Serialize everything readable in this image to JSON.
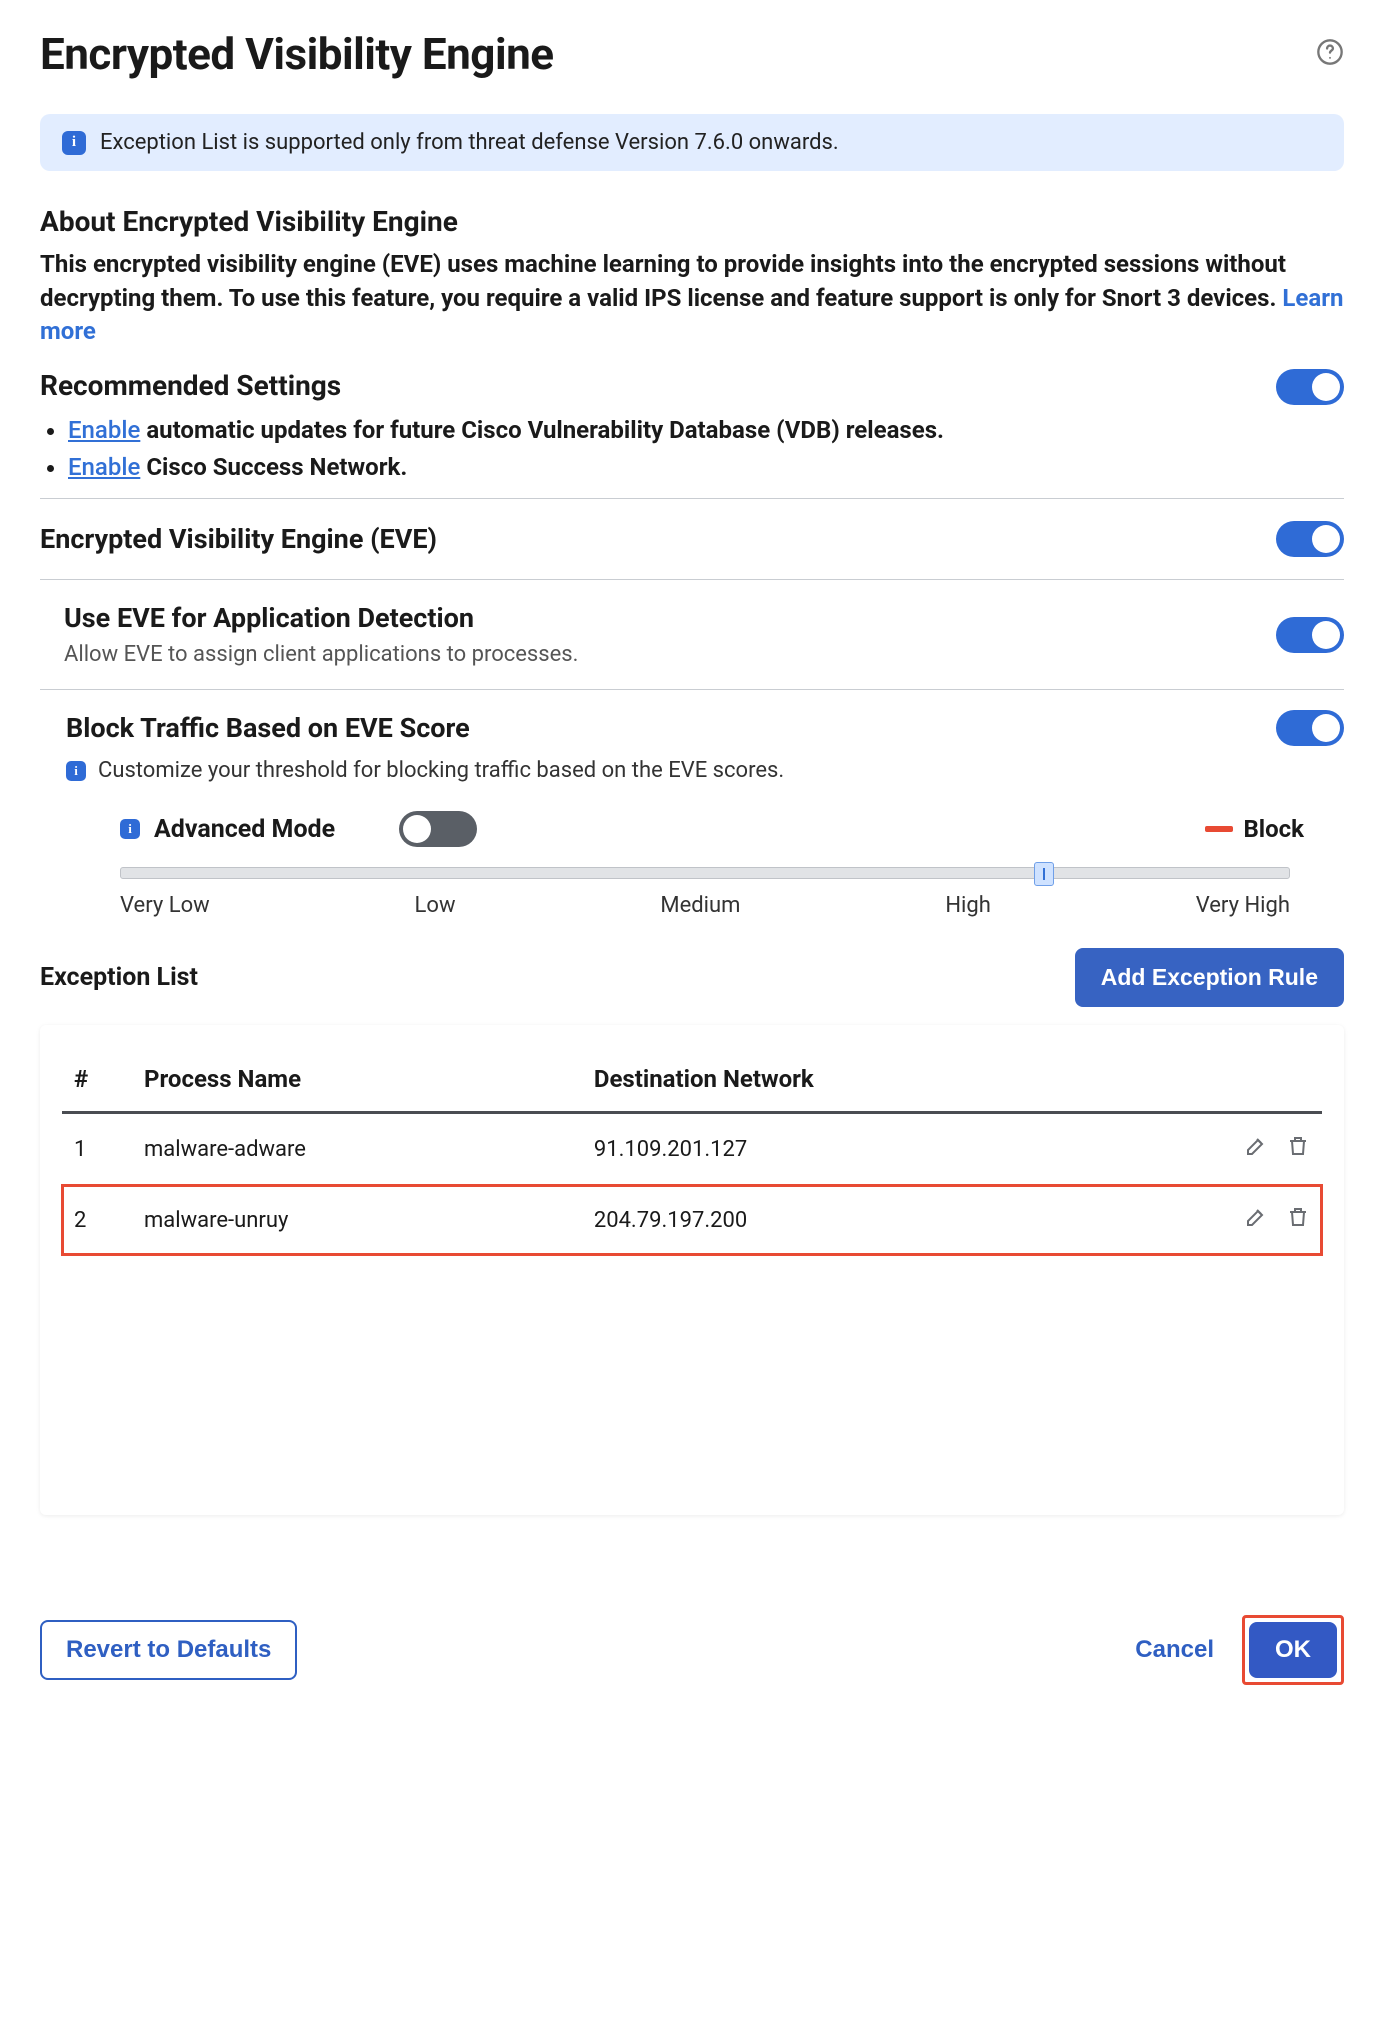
{
  "header": {
    "title": "Encrypted Visibility Engine"
  },
  "banner": {
    "text": "Exception List is supported only from threat defense Version 7.6.0 onwards."
  },
  "about": {
    "heading": "About Encrypted Visibility Engine",
    "body": "This encrypted visibility engine (EVE) uses machine learning to provide insights into the encrypted sessions without decrypting them. To use this feature, you require a valid IPS license and feature support is only for Snort 3 devices. ",
    "learn_more": "Learn more"
  },
  "recommended": {
    "heading": "Recommended Settings",
    "enable_label": "Enable",
    "items": [
      "automatic updates for future Cisco Vulnerability Database (VDB) releases.",
      "Cisco Success Network."
    ]
  },
  "eve_section": {
    "title": "Encrypted Visibility Engine (EVE)"
  },
  "app_detect": {
    "title": "Use EVE for Application Detection",
    "sub": "Allow EVE to assign client applications to processes."
  },
  "block_section": {
    "title": "Block Traffic Based on EVE Score",
    "sub": "Customize your threshold for blocking traffic based on the EVE scores.",
    "advanced_label": "Advanced Mode",
    "legend": "Block",
    "ticks": [
      "Very Low",
      "Low",
      "Medium",
      "High",
      "Very High"
    ]
  },
  "exception": {
    "heading": "Exception List",
    "add_button": "Add Exception Rule",
    "columns": {
      "idx": "#",
      "process": "Process Name",
      "dest": "Destination Network"
    },
    "rows": [
      {
        "idx": "1",
        "process": "malware-adware",
        "dest": "91.109.201.127",
        "highlight": false
      },
      {
        "idx": "2",
        "process": "malware-unruy",
        "dest": "204.79.197.200",
        "highlight": true
      }
    ]
  },
  "footer": {
    "revert": "Revert to Defaults",
    "cancel": "Cancel",
    "ok": "OK"
  }
}
